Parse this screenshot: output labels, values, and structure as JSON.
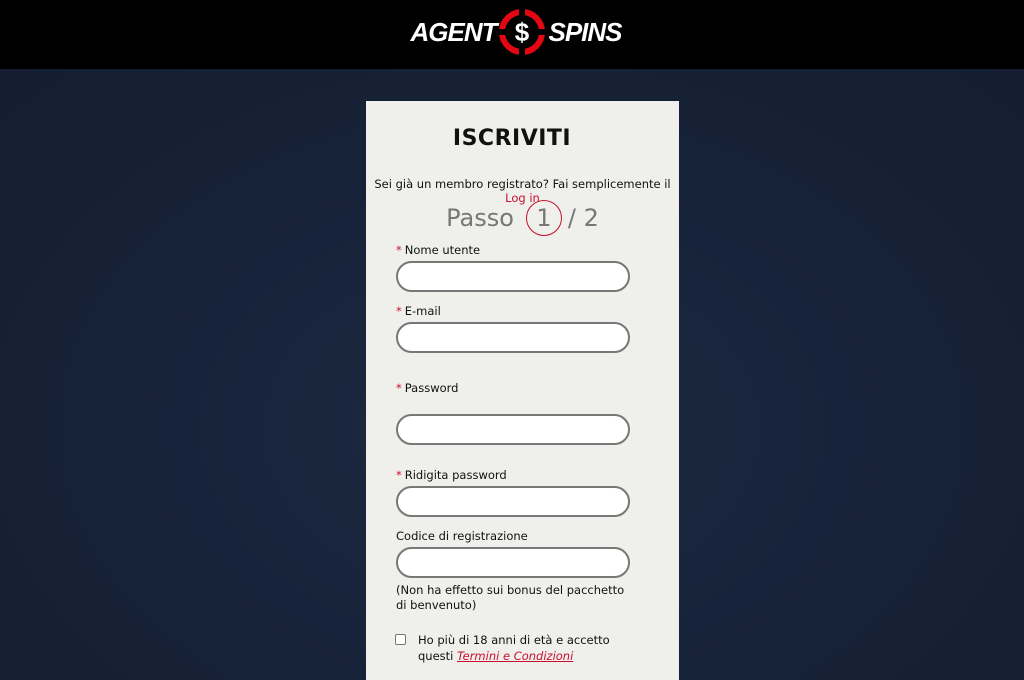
{
  "header": {
    "logo_left": "AGENT",
    "logo_symbol": "$",
    "logo_right": "SPINS",
    "logo_icon": "dollar-crosshair-icon"
  },
  "form": {
    "title": "ISCRIVITI",
    "already_member_text": "Sei già un membro registrato? Fai semplicemente il ",
    "login_link": "Log in",
    "step_label": "Passo",
    "step_current": "1",
    "step_total": "/ 2",
    "required_marker": "*",
    "fields": {
      "username": {
        "label": "Nome utente",
        "value": "",
        "required": true
      },
      "email": {
        "label": "E-mail",
        "value": "",
        "required": true
      },
      "password": {
        "label": "Password",
        "value": "",
        "required": true
      },
      "confirm_password": {
        "label": "Ridigita password",
        "value": "",
        "required": true
      },
      "registration_code": {
        "label": "Codice di registrazione",
        "value": "",
        "required": false
      }
    },
    "registration_code_note": "(Non ha effetto sui bonus del pacchetto di benvenuto)",
    "terms_text": "Ho più di 18 anni di età e accetto questi ",
    "terms_link": "Termini e Condizioni",
    "terms_checked": false
  },
  "colors": {
    "accent": "#c8102e",
    "header_bg": "#000000",
    "page_bg": "#1a2333",
    "card_bg": "#efefeb"
  }
}
